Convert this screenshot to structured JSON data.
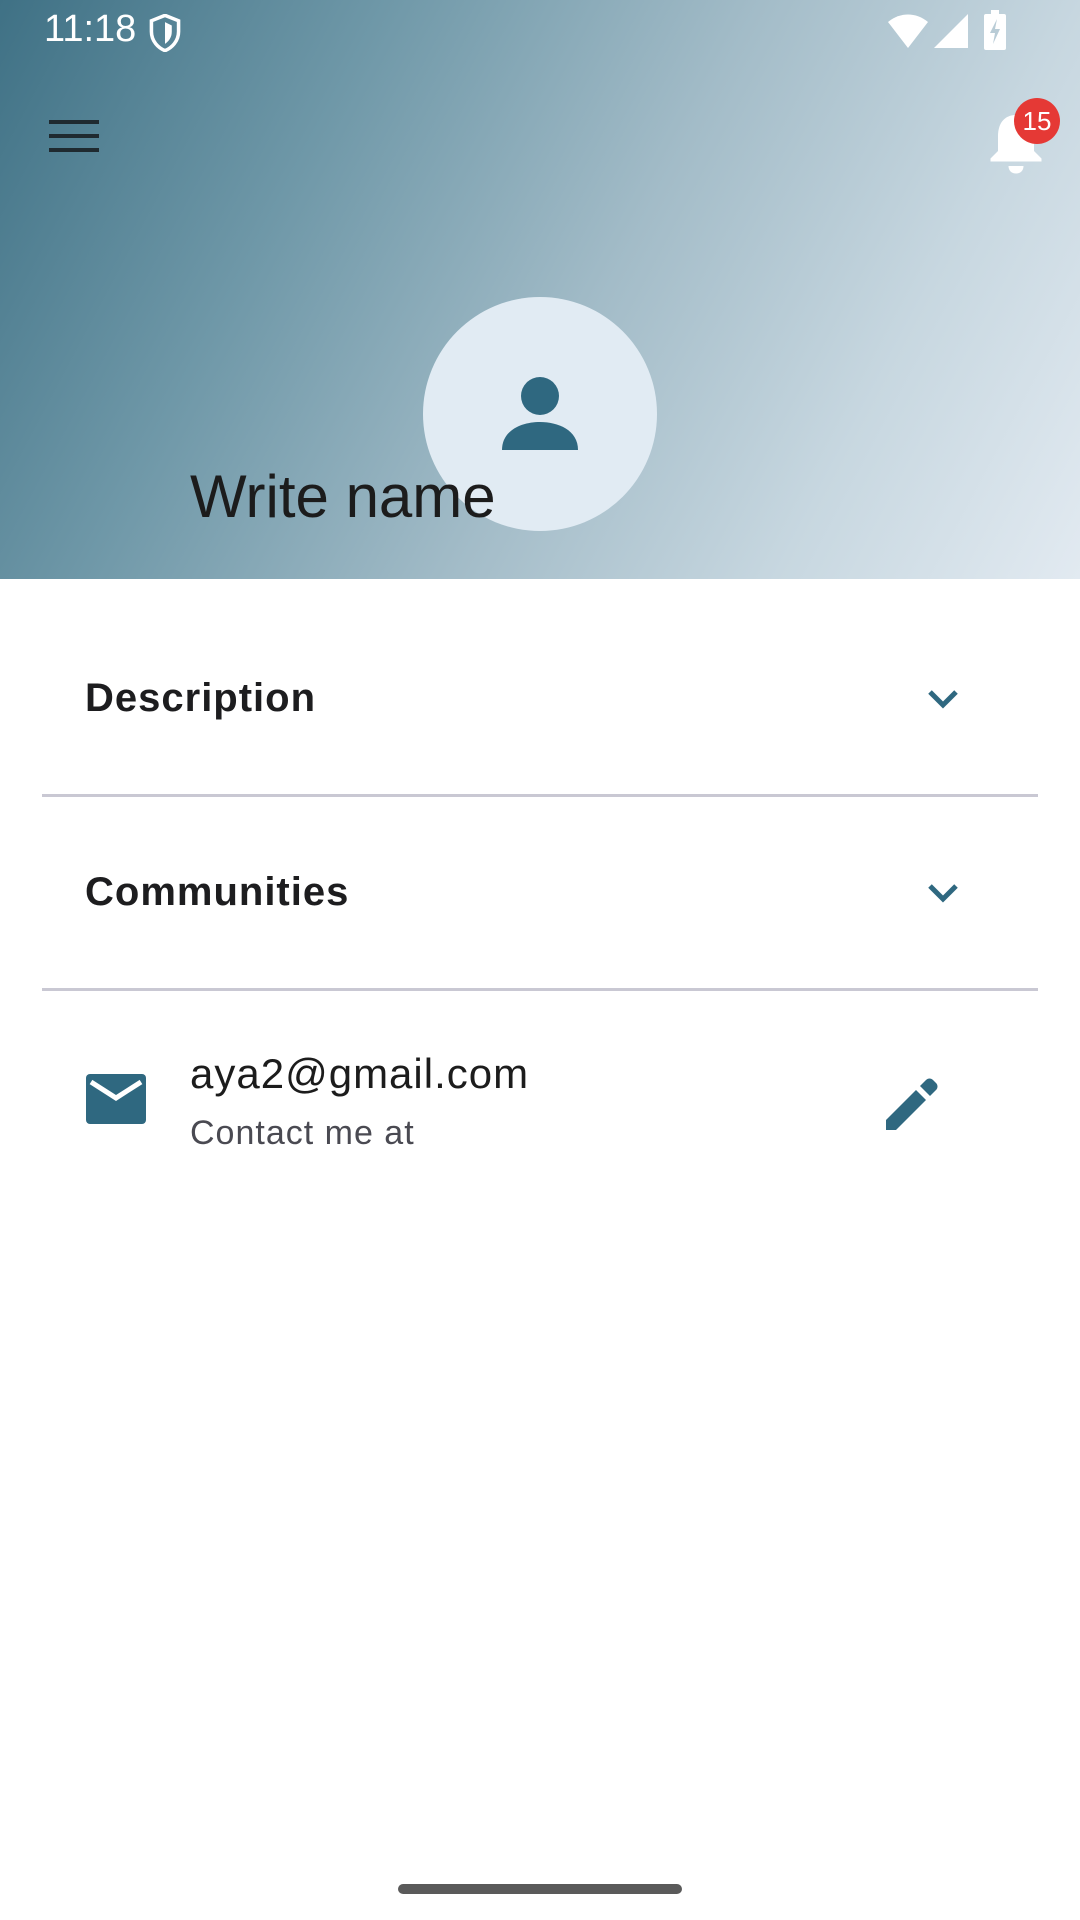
{
  "status_bar": {
    "time": "11:18",
    "icons": [
      "shield-icon",
      "wifi-icon",
      "signal-icon",
      "battery-charging-icon"
    ]
  },
  "header": {
    "menu_icon": "hamburger-menu-icon",
    "notification_icon": "bell-icon",
    "notification_count": "15",
    "badge_color": "#e53935",
    "gradient_colors": [
      "#3f7185",
      "#e2eaf1"
    ]
  },
  "profile": {
    "avatar_icon": "person-icon",
    "avatar_bg": "#e1ebf3",
    "name": "Write name"
  },
  "sections": [
    {
      "label": "Description",
      "icon": "chevron-down-icon"
    },
    {
      "label": "Communities",
      "icon": "chevron-down-icon"
    }
  ],
  "contact": {
    "icon": "mail-icon",
    "email": "aya2@gmail.com",
    "caption": "Contact me at",
    "edit_icon": "pencil-icon"
  },
  "theme": {
    "accent": "#2f6880",
    "divider": "#c9c8d3"
  }
}
